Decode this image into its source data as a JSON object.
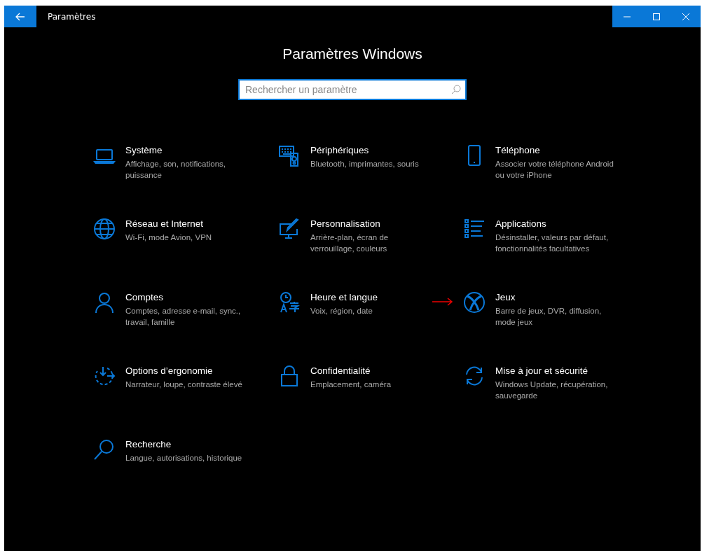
{
  "window": {
    "title": "Paramètres",
    "heading": "Paramètres Windows"
  },
  "search": {
    "placeholder": "Rechercher un paramètre"
  },
  "items": [
    {
      "kind": "laptop",
      "title": "Système",
      "description": "Affichage, son, notifications, puissance",
      "pointer": false
    },
    {
      "kind": "devices",
      "title": "Périphériques",
      "description": "Bluetooth, imprimantes, souris",
      "pointer": false
    },
    {
      "kind": "phone",
      "title": "Téléphone",
      "description": "Associer votre téléphone Android ou votre iPhone",
      "pointer": false
    },
    {
      "kind": "globe",
      "title": "Réseau et Internet",
      "description": "Wi-Fi, mode Avion, VPN",
      "pointer": false
    },
    {
      "kind": "paint",
      "title": "Personnalisation",
      "description": "Arrière-plan, écran de verrouillage, couleurs",
      "pointer": false
    },
    {
      "kind": "apps",
      "title": "Applications",
      "description": "Désinstaller, valeurs par défaut, fonctionnalités facultatives",
      "pointer": false
    },
    {
      "kind": "person",
      "title": "Comptes",
      "description": "Comptes, adresse e-mail, sync., travail, famille",
      "pointer": false
    },
    {
      "kind": "time",
      "title": "Heure et langue",
      "description": "Voix, région, date",
      "pointer": false
    },
    {
      "kind": "xbox",
      "title": "Jeux",
      "description": "Barre de jeux, DVR, diffusion, mode jeux",
      "pointer": true
    },
    {
      "kind": "ease",
      "title": "Options d’ergonomie",
      "description": "Narrateur, loupe, contraste élevé",
      "pointer": false
    },
    {
      "kind": "lock",
      "title": "Confidentialité",
      "description": "Emplacement, caméra",
      "pointer": false
    },
    {
      "kind": "update",
      "title": "Mise à jour et sécurité",
      "description": "Windows Update, récupération, sauvegarde",
      "pointer": false
    },
    {
      "kind": "search",
      "title": "Recherche",
      "description": "Langue, autorisations, historique",
      "pointer": false
    }
  ]
}
